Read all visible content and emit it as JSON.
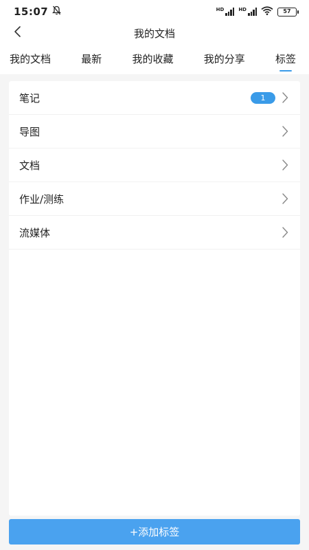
{
  "status_bar": {
    "time": "15:07",
    "network_label_1": "HD",
    "network_label_2": "HD",
    "battery": "57"
  },
  "header": {
    "title": "我的文档"
  },
  "tabs": [
    {
      "label": "我的文档",
      "active": false
    },
    {
      "label": "最新",
      "active": false
    },
    {
      "label": "我的收藏",
      "active": false
    },
    {
      "label": "我的分享",
      "active": false
    },
    {
      "label": "标签",
      "active": true
    }
  ],
  "list": [
    {
      "label": "笔记",
      "badge": "1"
    },
    {
      "label": "导图"
    },
    {
      "label": "文档"
    },
    {
      "label": "作业/测练"
    },
    {
      "label": "流媒体"
    }
  ],
  "footer": {
    "add_label": "+添加标签"
  },
  "colors": {
    "accent": "#3a9be8",
    "button": "#4aa2ef",
    "background": "#f5f5f5"
  },
  "icons": {
    "back": "chevron-left-icon",
    "row": "chevron-right-icon",
    "notification": "bell-off-icon",
    "signal": "signal-icon",
    "wifi": "wifi-icon",
    "battery": "battery-icon"
  }
}
